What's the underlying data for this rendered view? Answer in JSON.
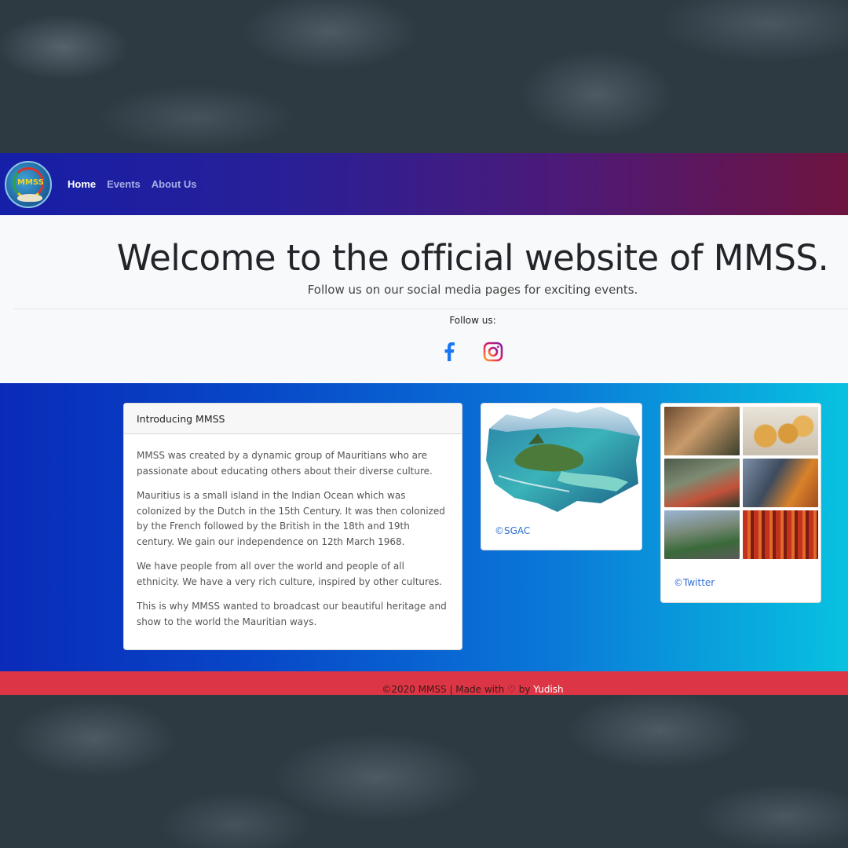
{
  "nav": {
    "logo_text": "MMSS",
    "links": [
      {
        "label": "Home",
        "active": true
      },
      {
        "label": "Events",
        "active": false
      },
      {
        "label": "About Us",
        "active": false
      }
    ]
  },
  "hero": {
    "title": "Welcome to the official website of MMSS.",
    "lead": "Follow us on our social media pages for exciting events.",
    "follow_label": "Follow us:",
    "social": [
      "facebook-icon",
      "instagram-icon"
    ]
  },
  "intro_card": {
    "header": "Introducing MMSS",
    "paragraphs": [
      "MMSS was created by a dynamic group of Mauritians who are passionate about educating others about their diverse culture.",
      "Mauritius is a small island in the Indian Ocean which was colonized by the Dutch in the 15th Century. It was then colonized by the French followed by the British in the 18th and 19th century. We gain our independence on 12th March 1968.",
      "We have people from all over the world and people of all ethnicity. We have a very rich culture, inspired by other cultures.",
      "This is why MMSS wanted to broadcast our beautiful heritage and show to the world the Mauritian ways."
    ]
  },
  "image_cards": [
    {
      "credit": "©SGAC"
    },
    {
      "credit": "©Twitter"
    }
  ],
  "footer": {
    "text_before": "©2020 MMSS | Made with",
    "heart": "♡",
    "text_by": "by",
    "author": "Yudish"
  },
  "colors": {
    "footer_red": "#dc3545",
    "link_blue": "#2f6fd6"
  }
}
